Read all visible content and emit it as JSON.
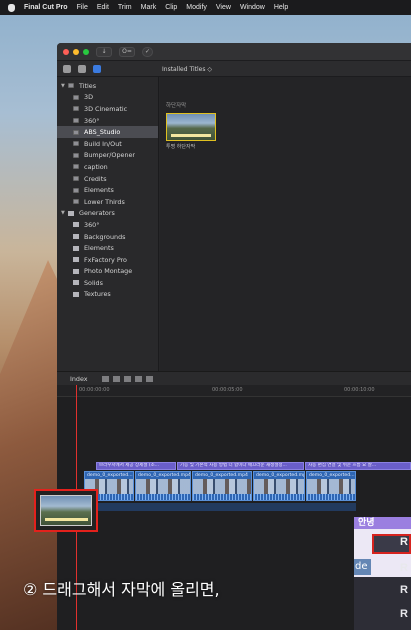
{
  "menubar": {
    "app": "Final Cut Pro",
    "items": [
      "File",
      "Edit",
      "Trim",
      "Mark",
      "Clip",
      "Modify",
      "View",
      "Window",
      "Help"
    ]
  },
  "window": {
    "toolbar_key_label": "O=",
    "browser_header": "Installed Titles ◇"
  },
  "sidebar": {
    "titles_label": "Titles",
    "title_items": [
      "3D",
      "3D Cinematic",
      "360°",
      "ABS_Studio",
      "Build In/Out",
      "Bumper/Opener",
      "caption",
      "Credits",
      "Elements",
      "Lower Thirds"
    ],
    "selected_title": "ABS_Studio",
    "generators_label": "Generators",
    "generator_items": [
      "360°",
      "Backgrounds",
      "Elements",
      "FxFactory Pro",
      "Photo Montage",
      "Solids",
      "Textures"
    ]
  },
  "browser": {
    "section_label": "하단자막",
    "thumb_label": "투명 하단자막"
  },
  "timeline": {
    "index_label": "Index",
    "ruler": [
      "00:00:00:00",
      "00:00:05:00",
      "00:00:10:00"
    ],
    "title_clips": [
      "브라우저에서 제공 상세설 (소...",
      "기능 및 기본적 사용 방법 더 합이다 매끄러운 재생설정...",
      "자동 편집 연결 및 쉬운 흐름 요 잘..."
    ],
    "video_clips": [
      "demo_0_exported...",
      "demo_0_exported.mp4",
      "demo_0_exported.mp4",
      "demo_0_exported.mp4",
      "demo_0_exported..."
    ]
  },
  "overlay": {
    "korean_text": "안녕",
    "de_text": "de",
    "r_letters": [
      "R",
      "R",
      "R",
      "R"
    ]
  },
  "caption": "② 드래그해서 자막에 올리면,",
  "colors": {
    "selection_red": "#e3211c",
    "title_clip_purple": "#6a5ec9",
    "video_clip_blue": "#2f66b3",
    "playhead": "#e0312e"
  }
}
